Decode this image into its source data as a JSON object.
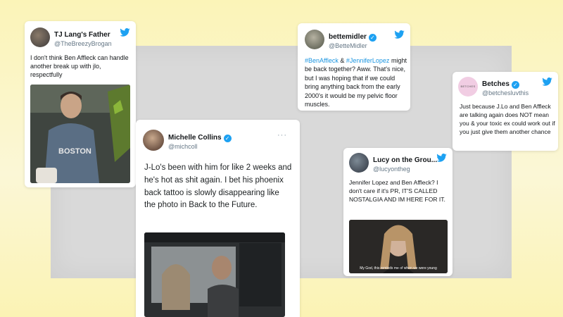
{
  "colors": {
    "background": "#fbf5c4",
    "panel": "#d9d9d9",
    "twitter_blue": "#1da1f2",
    "hashtag": "#1b95e0"
  },
  "tweets": [
    {
      "display_name": "TJ Lang's Father",
      "handle": "@TheBreezyBrogan",
      "verified": false,
      "text": "I don't think Ben Affleck can handle another break up with jlo, respectfully",
      "icon": "twitter-bird-icon",
      "media_text": "BOSTON"
    },
    {
      "display_name": "Michelle Collins",
      "handle": "@michcoll",
      "verified": true,
      "more": "···",
      "text": "J-Lo's been with him for like 2 weeks and he's hot as shit again. I bet his phoenix back tattoo is slowly disappearing like the photo in Back to the Future."
    },
    {
      "display_name": "bettemidler",
      "handle": "@BetteMidler",
      "verified": true,
      "hashtag_1": "#BenAffleck",
      "amp": " & ",
      "hashtag_2": "#JenniferLopez",
      "text": "might be back together? Aww. That's nice, but I was hoping that if we could bring anything back from the early 2000's it would be my pelvic floor muscles.",
      "icon": "twitter-bird-icon"
    },
    {
      "display_name": "Betches",
      "handle": "@betchesluvthis",
      "verified": true,
      "avatar_text": "BETCHES",
      "text": "Just because J.Lo and Ben Affleck are talking again does NOT mean you & your toxic ex could work out if you just give them another chance",
      "icon": "twitter-bird-icon"
    },
    {
      "display_name": "Lucy on the Grou...",
      "handle": "@lucyontheg",
      "verified": false,
      "text": "Jennifer Lopez and Ben Affleck? I don't care if it's PR, IT'S CALLED NOSTALGIA AND IM HERE FOR IT.",
      "media_caption": "My God, this reminds me of when we were young",
      "icon": "twitter-bird-icon"
    }
  ]
}
